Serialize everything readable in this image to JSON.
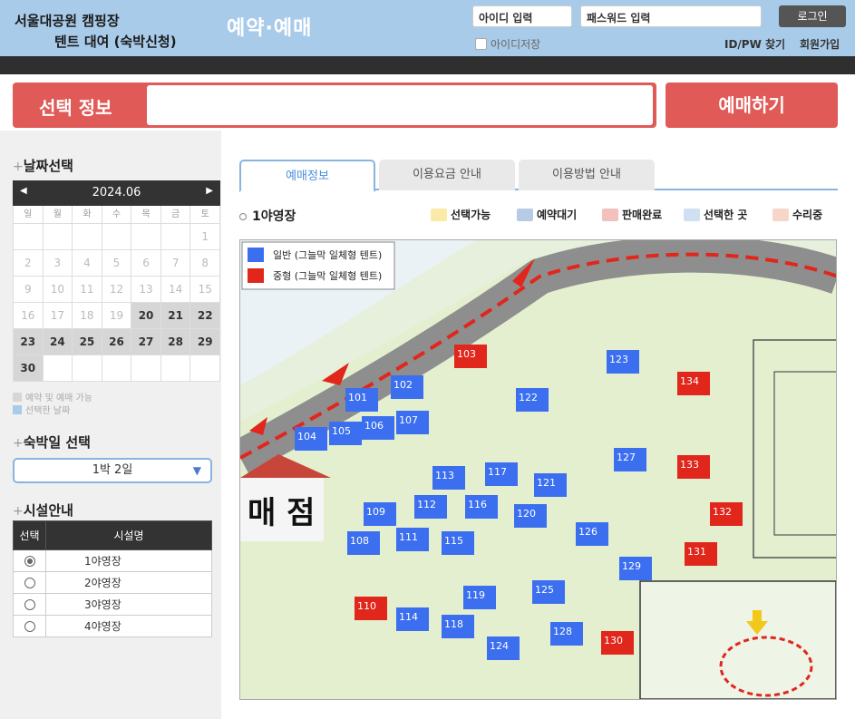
{
  "header": {
    "title_line1": "서울대공원 캠핑장",
    "title_line2": "텐트 대여 (숙박신청)",
    "section": "예약·예매",
    "id_placeholder": "아이디 입력",
    "pw_placeholder": "패스워드 입력",
    "login_label": "로그인",
    "save_id_label": "아이디저장",
    "find_label": "ID/PW 찾기",
    "signup_label": "회원가입"
  },
  "selection": {
    "label": "선택 정보",
    "value": "",
    "book_label": "예매하기"
  },
  "date_section": {
    "title": "날짜선택",
    "month": "2024.06",
    "weekdays": [
      "일",
      "월",
      "화",
      "수",
      "목",
      "금",
      "토"
    ],
    "legend_available": "예약 및 예매 가능",
    "legend_selected": "선택한 날짜"
  },
  "nights_section": {
    "title": "숙박일 선택",
    "selected": "1박 2일"
  },
  "facility_section": {
    "title": "시설안내",
    "col_select": "선택",
    "col_name": "시설명",
    "rows": [
      {
        "name": "1야영장",
        "selected": true
      },
      {
        "name": "2야영장",
        "selected": false
      },
      {
        "name": "3야영장",
        "selected": false
      },
      {
        "name": "4야영장",
        "selected": false
      }
    ]
  },
  "tabs": [
    {
      "label": "예매정보",
      "active": true
    },
    {
      "label": "이용요금 안내",
      "active": false
    },
    {
      "label": "이용방법 안내",
      "active": false
    }
  ],
  "area_title": "1야영장",
  "status_legend": [
    "선택가능",
    "예약대기",
    "판매완료",
    "선택한 곳",
    "수리중"
  ],
  "map": {
    "legend_general": "일반 (그늘막 일체형 텐트)",
    "legend_medium": "중형 (그늘막 일체형 텐트)",
    "shop_label": "매 점",
    "colors": {
      "general": "#3b6ff0",
      "medium": "#e1261c"
    },
    "sites": [
      {
        "n": "101",
        "t": "g"
      },
      {
        "n": "102",
        "t": "g"
      },
      {
        "n": "103",
        "t": "m"
      },
      {
        "n": "104",
        "t": "g"
      },
      {
        "n": "105",
        "t": "g"
      },
      {
        "n": "106",
        "t": "g"
      },
      {
        "n": "107",
        "t": "g"
      },
      {
        "n": "108",
        "t": "g"
      },
      {
        "n": "109",
        "t": "g"
      },
      {
        "n": "110",
        "t": "m"
      },
      {
        "n": "111",
        "t": "g"
      },
      {
        "n": "112",
        "t": "g"
      },
      {
        "n": "113",
        "t": "g"
      },
      {
        "n": "114",
        "t": "g"
      },
      {
        "n": "115",
        "t": "g"
      },
      {
        "n": "116",
        "t": "g"
      },
      {
        "n": "117",
        "t": "g"
      },
      {
        "n": "118",
        "t": "g"
      },
      {
        "n": "119",
        "t": "g"
      },
      {
        "n": "120",
        "t": "g"
      },
      {
        "n": "121",
        "t": "g"
      },
      {
        "n": "122",
        "t": "g"
      },
      {
        "n": "123",
        "t": "g"
      },
      {
        "n": "124",
        "t": "g"
      },
      {
        "n": "125",
        "t": "g"
      },
      {
        "n": "126",
        "t": "g"
      },
      {
        "n": "127",
        "t": "g"
      },
      {
        "n": "128",
        "t": "g"
      },
      {
        "n": "129",
        "t": "g"
      },
      {
        "n": "130",
        "t": "m"
      },
      {
        "n": "131",
        "t": "m"
      },
      {
        "n": "132",
        "t": "m"
      },
      {
        "n": "133",
        "t": "m"
      },
      {
        "n": "134",
        "t": "m"
      }
    ]
  }
}
